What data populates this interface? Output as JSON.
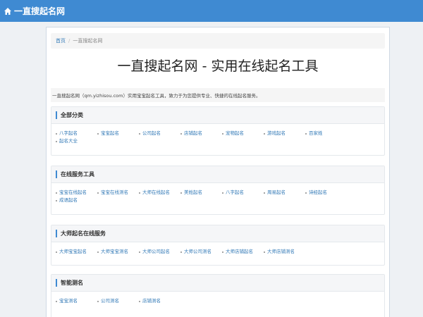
{
  "site": {
    "brand": "一直搜起名网"
  },
  "breadcrumb": {
    "home": "首页",
    "separator": "/",
    "current": "一直搜起名网"
  },
  "page": {
    "title": "一直搜起名网 - 实用在线起名工具",
    "intro": "一直搜起名网（qm.yizhisou.com）实用宝宝起名工具，致力于为您提供专业、快捷的在线起名服务。"
  },
  "sections": [
    {
      "title": "全部分类",
      "links": [
        "八字起名",
        "宝宝起名",
        "公司起名",
        "店铺起名",
        "宠物起名",
        "游戏起名",
        "百家姓",
        "起名大全"
      ]
    },
    {
      "title": "在线服务工具",
      "links": [
        "宝宝在线起名",
        "宝宝在线测名",
        "大师在线起名",
        "美姓起名",
        "八字起名",
        "周易起名",
        "诗经起名",
        "成语起名"
      ]
    },
    {
      "title": "大师起名在线服务",
      "links": [
        "大师宝宝起名",
        "大师宝宝测名",
        "大师公司起名",
        "大师公司测名",
        "大师店铺起名",
        "大师店铺测名"
      ]
    },
    {
      "title": "智能测名",
      "links": [
        "宝宝测名",
        "公司测名",
        "店铺测名"
      ]
    }
  ]
}
